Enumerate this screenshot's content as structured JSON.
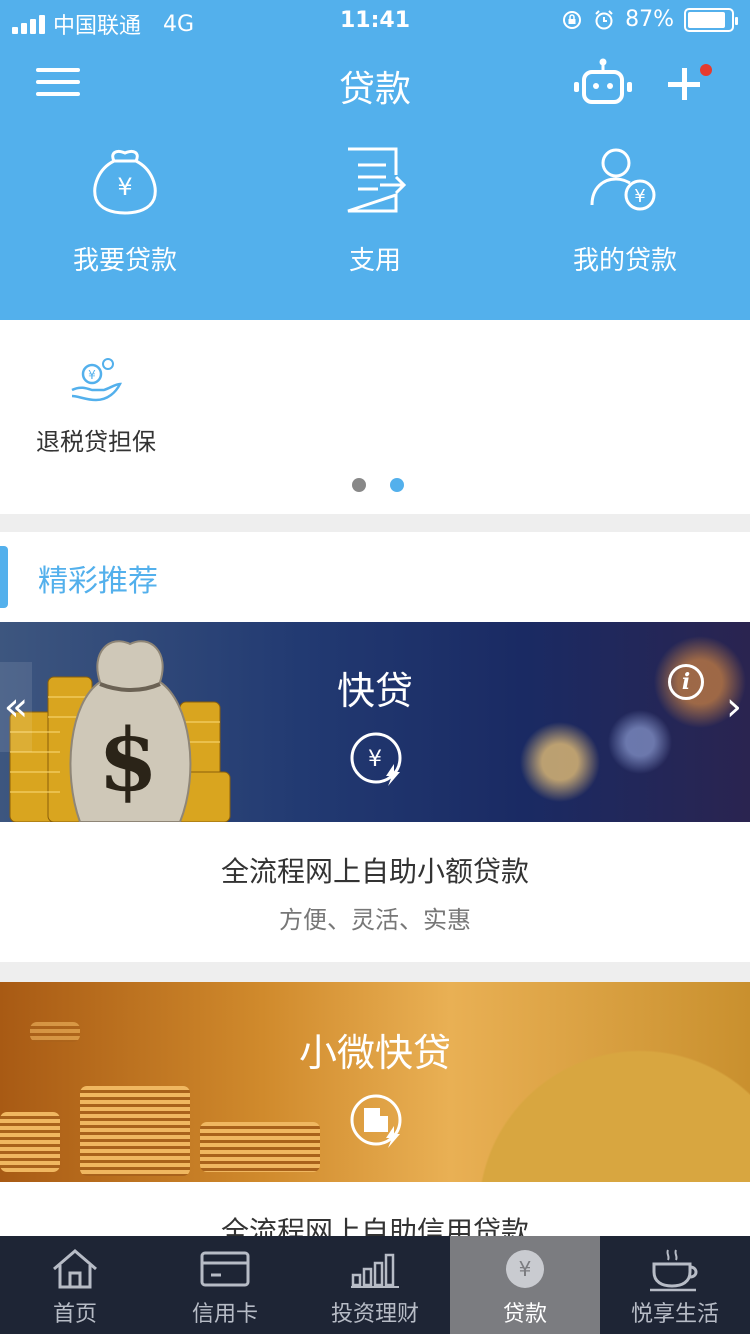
{
  "status_bar": {
    "carrier": "中国联通",
    "network": "4G",
    "time": "11:41",
    "battery": "87%",
    "battery_level": 0.87
  },
  "header": {
    "title": "贷款",
    "menu_icon": "menu-icon",
    "robot_icon": "robot-icon",
    "add_icon": "plus-icon"
  },
  "quick_actions": [
    {
      "label": "我要贷款",
      "icon": "money-bag-icon"
    },
    {
      "label": "支用",
      "icon": "document-arrow-icon"
    },
    {
      "label": "我的贷款",
      "icon": "user-yuan-icon"
    }
  ],
  "services": {
    "items": [
      {
        "label": "退税贷担保",
        "icon": "hand-coin-icon"
      }
    ],
    "pager": {
      "total": 2,
      "active": 2
    }
  },
  "section": {
    "title": "精彩推荐"
  },
  "products": [
    {
      "banner_title": "快贷",
      "headline": "全流程网上自助小额贷款",
      "tagline": "方便、灵活、实惠"
    },
    {
      "banner_title": "小微快贷",
      "headline": "全流程网上自助信用贷款"
    }
  ],
  "tabbar": [
    {
      "label": "首页",
      "icon": "home-icon"
    },
    {
      "label": "信用卡",
      "icon": "credit-card-icon"
    },
    {
      "label": "投资理财",
      "icon": "bar-chart-icon"
    },
    {
      "label": "贷款",
      "icon": "yuan-coin-icon",
      "active": true
    },
    {
      "label": "悦享生活",
      "icon": "coffee-cup-icon"
    }
  ],
  "colors": {
    "primary": "#53b0ec",
    "tabbar": "#1e2535",
    "notification": "#e63a2e"
  }
}
